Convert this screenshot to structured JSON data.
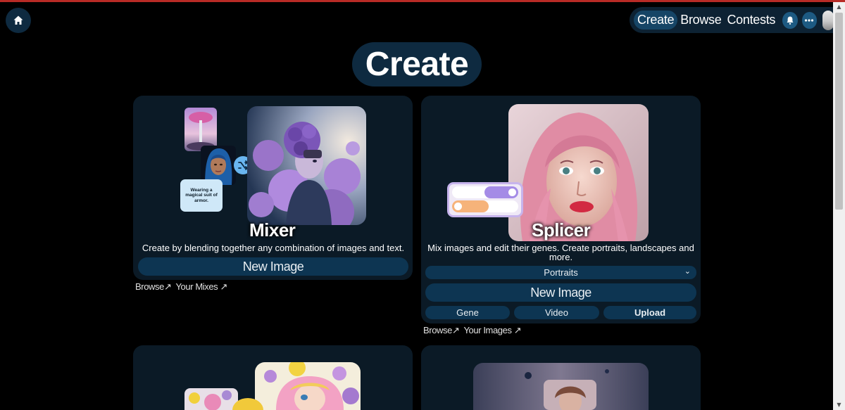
{
  "nav": {
    "home_icon": "home-icon",
    "links": [
      "Create",
      "Browse",
      "Contests"
    ],
    "active": "Create",
    "bell_icon": "bell-icon",
    "more_icon": "more-icon"
  },
  "page": {
    "title": "Create"
  },
  "mixer": {
    "title": "Mixer",
    "description": "Create by blending together any combination of images and text.",
    "new_image": "New Image",
    "prompt_card": "Wearing a magical suit of armor.",
    "shuffle_icon": "shuffle-icon",
    "links": [
      "Browse↗",
      "Your Mixes ↗"
    ]
  },
  "splicer": {
    "title": "Splicer",
    "description": "Mix images and edit their genes. Create portraits, landscapes and more.",
    "select_value": "Portraits",
    "new_image": "New Image",
    "buttons": [
      "Gene",
      "Video",
      "Upload"
    ],
    "links": [
      "Browse↗",
      "Your Images ↗"
    ]
  },
  "colors": {
    "accent": "#0d3552",
    "card": "#0b1a26",
    "stripe": "#b82b26"
  }
}
